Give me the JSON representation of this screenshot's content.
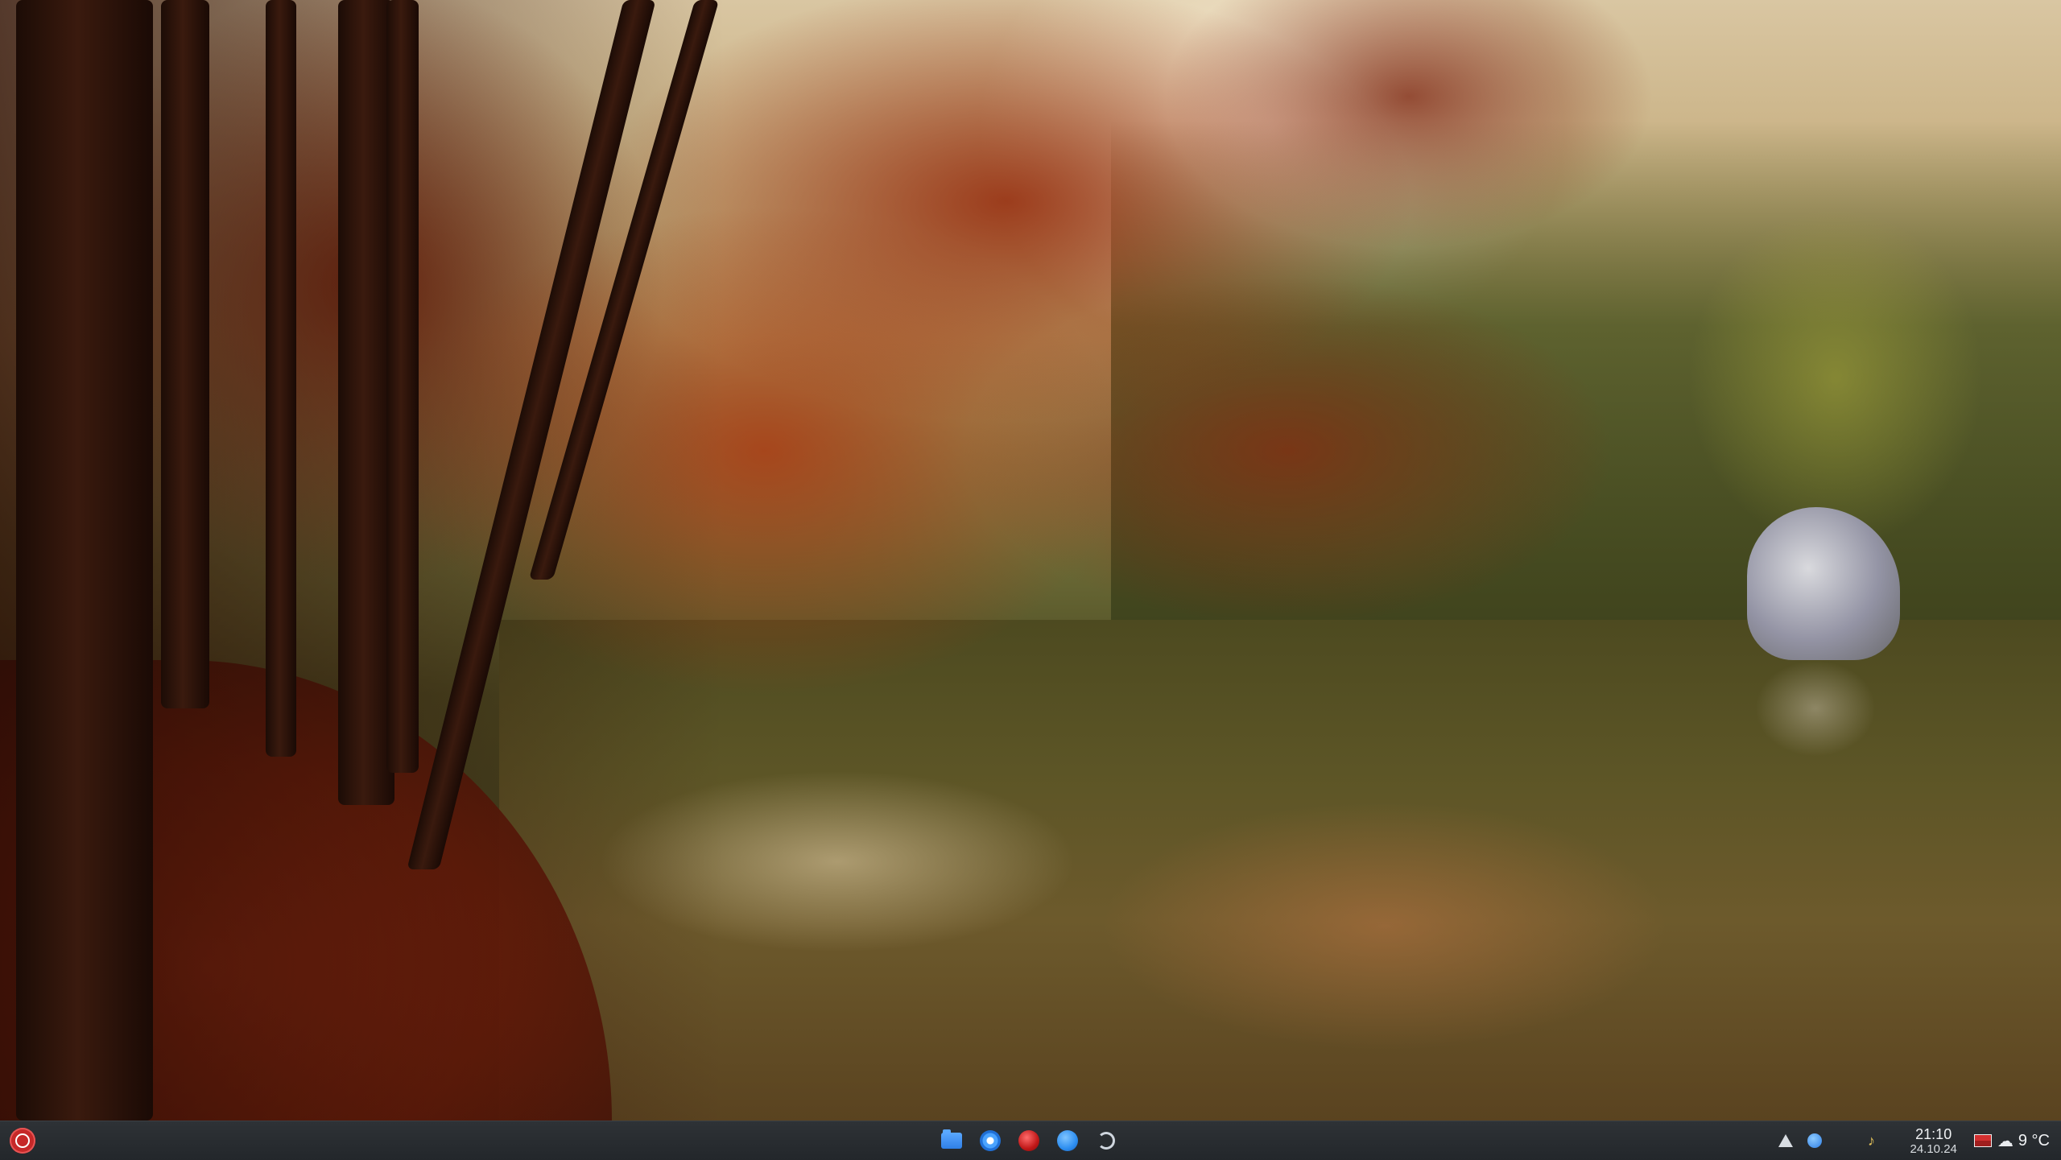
{
  "desktop": {
    "wallpaper": "autumn-lake"
  },
  "taskbar": {
    "launcher_icon": "application-launcher-icon",
    "tasks": [
      {
        "id": "files",
        "icon": "folder-icon"
      },
      {
        "id": "browser",
        "icon": "browser-globe-icon"
      },
      {
        "id": "recorder",
        "icon": "red-record-icon"
      },
      {
        "id": "chat",
        "icon": "blue-app-icon"
      },
      {
        "id": "update",
        "icon": "update-sync-icon"
      }
    ],
    "tray": {
      "network_icon": "network-icon",
      "bluetooth_icon": "bluetooth-icon",
      "audio_icon": "audio-icon",
      "clock_time": "21:10",
      "clock_date": "24.10.24",
      "flag_icon": "keyboard-layout-flag-icon",
      "weather_icon": "weather-cloud-icon",
      "weather_temp": "9 °C"
    },
    "colors": {
      "panel_bg": "#2a2e32",
      "launcher": "#c62828",
      "accent_blue": "#2f7fe6"
    }
  }
}
